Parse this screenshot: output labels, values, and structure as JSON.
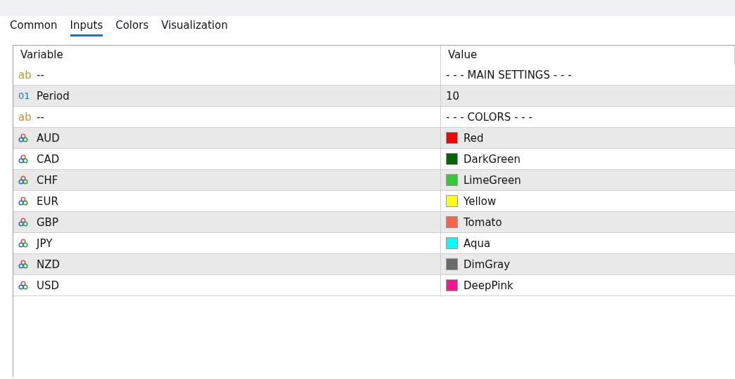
{
  "tabs": [
    {
      "label": "Common",
      "selected": false
    },
    {
      "label": "Inputs",
      "selected": true
    },
    {
      "label": "Colors",
      "selected": false
    },
    {
      "label": "Visualization",
      "selected": false
    }
  ],
  "table": {
    "columns": [
      "Variable",
      "Value"
    ],
    "rows": [
      {
        "kind": "text",
        "type_icon": "ab",
        "variable": "--",
        "value": "- - - MAIN SETTINGS - - -"
      },
      {
        "kind": "number",
        "type_icon": "01",
        "variable": "Period",
        "value": "10"
      },
      {
        "kind": "text",
        "type_icon": "ab",
        "variable": "--",
        "value": "- - - COLORS - - -"
      },
      {
        "kind": "color",
        "variable": "AUD",
        "value": "Red",
        "color": "#ff0000"
      },
      {
        "kind": "color",
        "variable": "CAD",
        "value": "DarkGreen",
        "color": "#006400"
      },
      {
        "kind": "color",
        "variable": "CHF",
        "value": "LimeGreen",
        "color": "#32cd32"
      },
      {
        "kind": "color",
        "variable": "EUR",
        "value": "Yellow",
        "color": "#ffff00"
      },
      {
        "kind": "color",
        "variable": "GBP",
        "value": "Tomato",
        "color": "#ff6347"
      },
      {
        "kind": "color",
        "variable": "JPY",
        "value": "Aqua",
        "color": "#00ffff"
      },
      {
        "kind": "color",
        "variable": "NZD",
        "value": "DimGray",
        "color": "#696969"
      },
      {
        "kind": "color",
        "variable": "USD",
        "value": "DeepPink",
        "color": "#ff1493"
      }
    ]
  }
}
